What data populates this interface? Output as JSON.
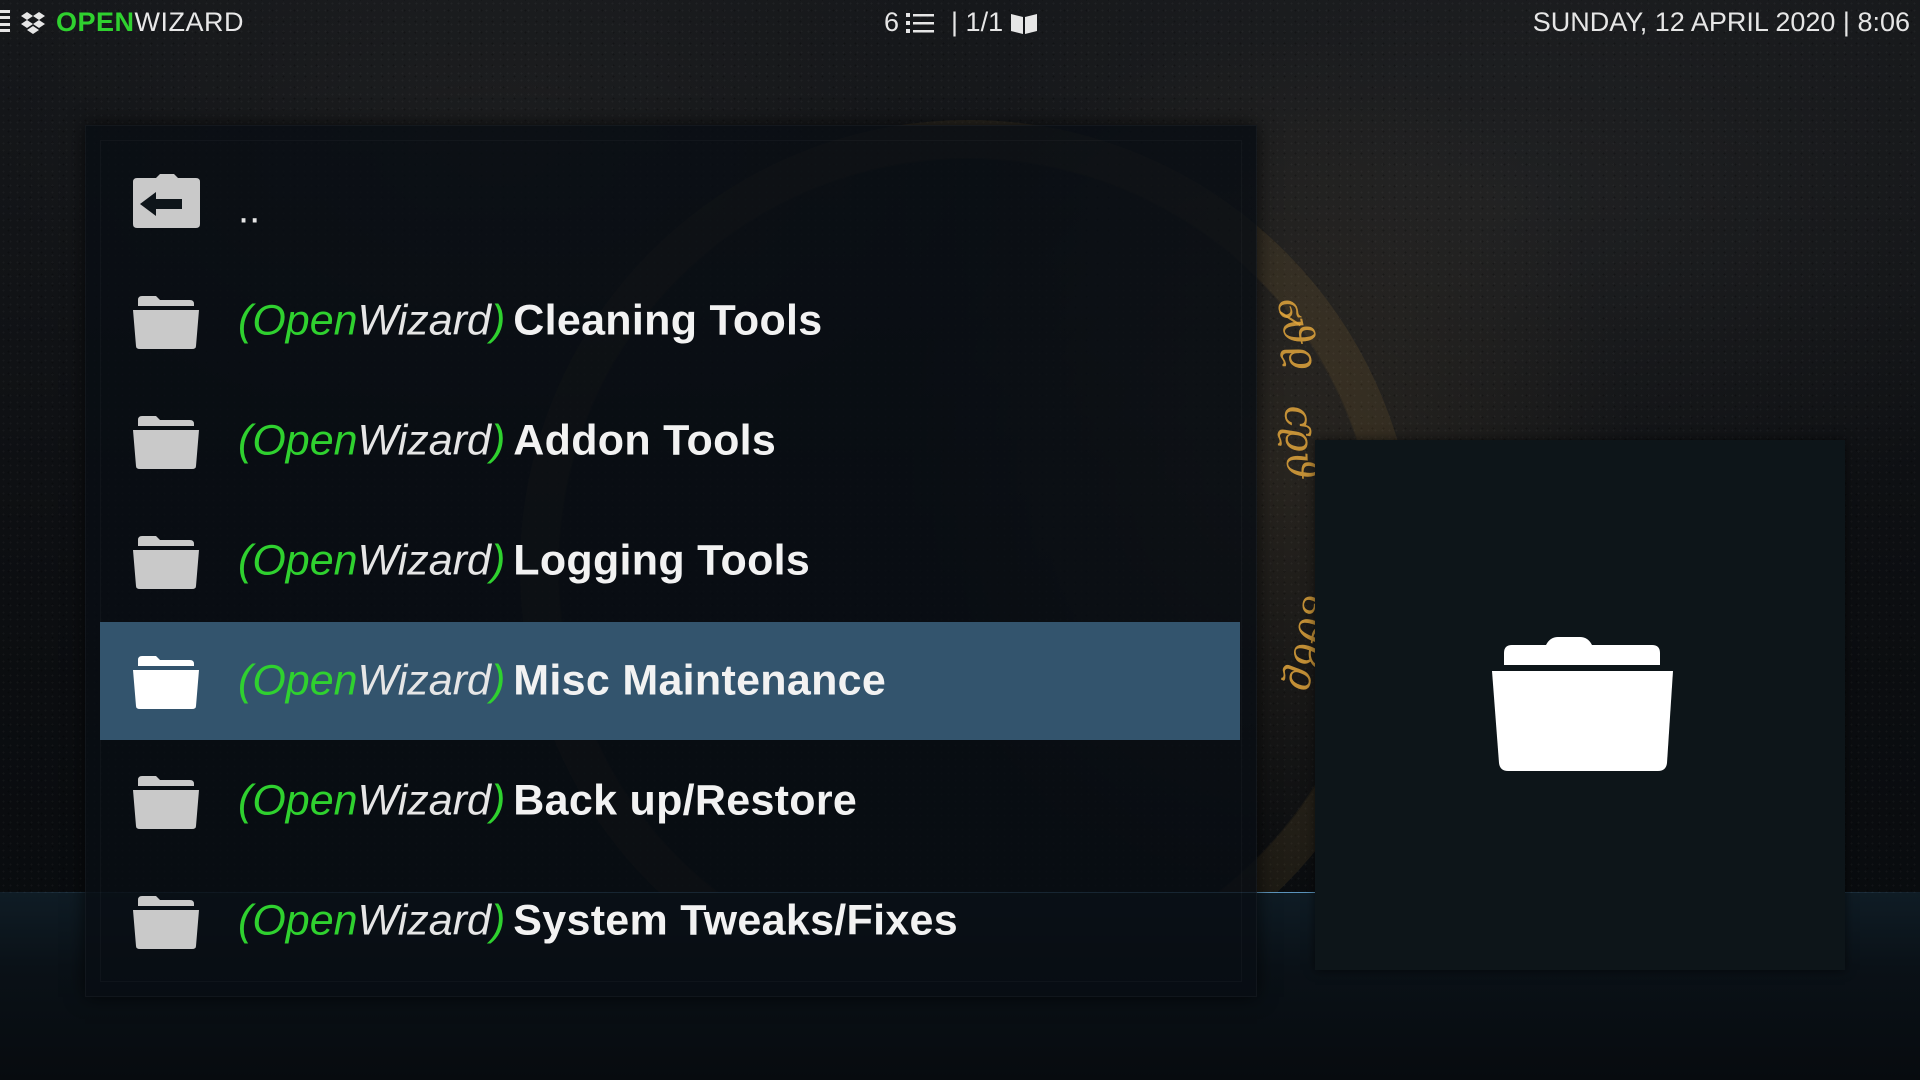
{
  "topbar": {
    "brand_green": "OPEN",
    "brand_white": "WIZARD",
    "item_count": "6",
    "page_info": "| 1/1",
    "datetime": "SUNDAY, 12 APRIL 2020 | 8:06"
  },
  "list": {
    "parent_label": "..",
    "prefix_open": "Open",
    "prefix_wizard": "Wizard",
    "paren_open": "(",
    "paren_close": ")",
    "items": [
      {
        "name": "Cleaning Tools",
        "selected": false
      },
      {
        "name": "Addon Tools",
        "selected": false
      },
      {
        "name": "Logging Tools",
        "selected": false
      },
      {
        "name": "Misc Maintenance",
        "selected": true
      },
      {
        "name": "Back up/Restore",
        "selected": false
      },
      {
        "name": "System Tweaks/Fixes",
        "selected": false
      }
    ]
  },
  "icons": {
    "menu": "hamburger-icon",
    "logo": "dropbox-style-logo-icon",
    "list": "list-icon",
    "book": "book-icon",
    "back_folder": "folder-back-icon",
    "folder": "folder-icon"
  },
  "colors": {
    "accent_green": "#2fd12f",
    "selected_row": "#33546d",
    "panel_bg": "#080e13"
  }
}
